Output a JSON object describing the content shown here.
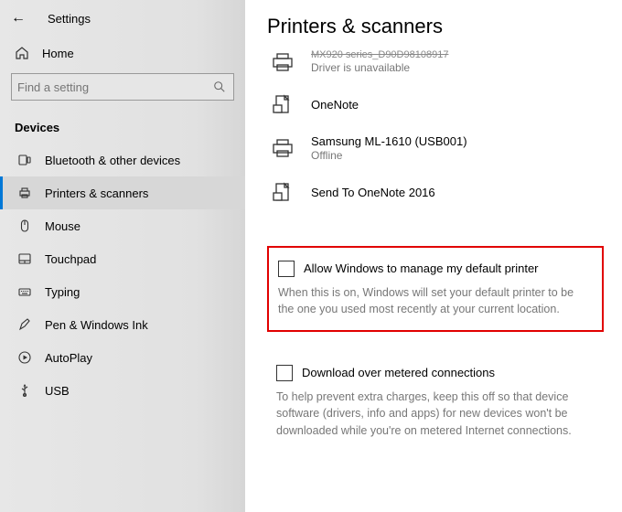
{
  "app_title": "Settings",
  "home_label": "Home",
  "search": {
    "placeholder": "Find a setting"
  },
  "sidebar_section": "Devices",
  "sidebar_items": [
    {
      "label": "Bluetooth & other devices"
    },
    {
      "label": "Printers & scanners"
    },
    {
      "label": "Mouse"
    },
    {
      "label": "Touchpad"
    },
    {
      "label": "Typing"
    },
    {
      "label": "Pen & Windows Ink"
    },
    {
      "label": "AutoPlay"
    },
    {
      "label": "USB"
    }
  ],
  "page_title": "Printers & scanners",
  "devices": [
    {
      "name": "MX920 series_D90D98108917",
      "status": "Driver is unavailable"
    },
    {
      "name": "OneNote",
      "status": ""
    },
    {
      "name": "Samsung ML-1610 (USB001)",
      "status": "Offline"
    },
    {
      "name": "Send To OneNote 2016",
      "status": ""
    }
  ],
  "option1": {
    "label": "Allow Windows to manage my default printer",
    "desc": "When this is on, Windows will set your default printer to be the one you used most recently at your current location."
  },
  "option2": {
    "label": "Download over metered connections",
    "desc": "To help prevent extra charges, keep this off so that device software (drivers, info and apps) for new devices won't be downloaded while you're on metered Internet connections."
  }
}
